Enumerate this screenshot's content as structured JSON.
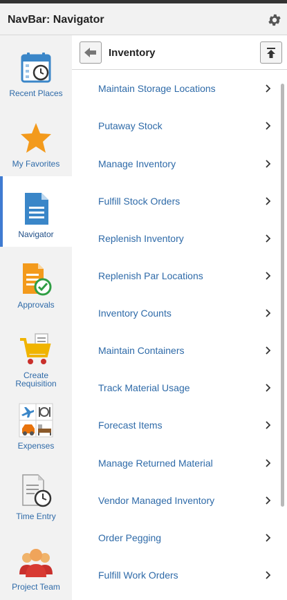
{
  "header": {
    "title": "NavBar: Navigator"
  },
  "sidebar": {
    "items": [
      {
        "label": "Recent Places"
      },
      {
        "label": "My Favorites"
      },
      {
        "label": "Navigator"
      },
      {
        "label": "Approvals"
      },
      {
        "label": "Create Requisition"
      },
      {
        "label": "Expenses"
      },
      {
        "label": "Time Entry"
      },
      {
        "label": "Project Team"
      }
    ]
  },
  "panel": {
    "title": "Inventory",
    "items": [
      {
        "label": "Maintain Storage Locations"
      },
      {
        "label": "Putaway Stock"
      },
      {
        "label": "Manage Inventory"
      },
      {
        "label": "Fulfill Stock Orders"
      },
      {
        "label": "Replenish Inventory"
      },
      {
        "label": "Replenish Par Locations"
      },
      {
        "label": "Inventory Counts"
      },
      {
        "label": "Maintain Containers"
      },
      {
        "label": "Track Material Usage"
      },
      {
        "label": "Forecast Items"
      },
      {
        "label": "Manage Returned Material"
      },
      {
        "label": "Vendor Managed Inventory"
      },
      {
        "label": "Order Pegging"
      },
      {
        "label": "Fulfill Work Orders"
      }
    ]
  },
  "colors": {
    "link": "#2e6aa8",
    "accent": "#3f7bd1",
    "sidebar_bg": "#f2f2f2"
  }
}
